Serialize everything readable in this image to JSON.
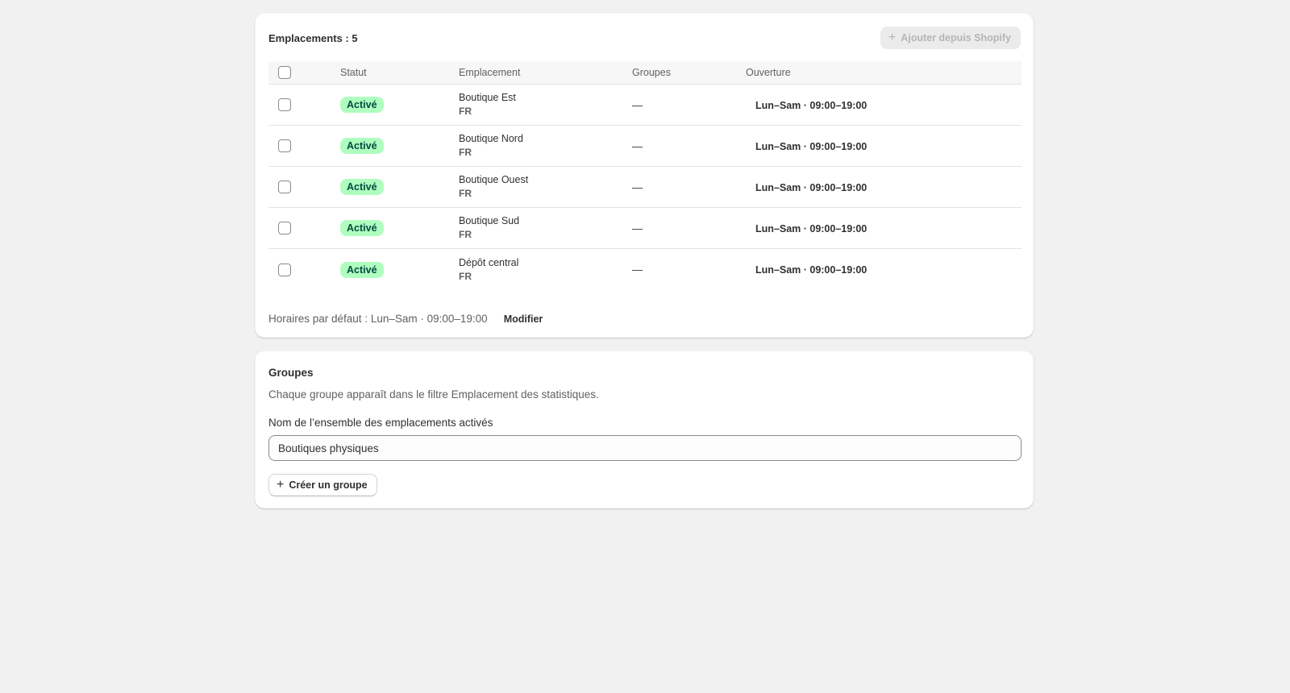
{
  "locations_card": {
    "count_label": "Emplacements : 5",
    "add_button_label": "Ajouter depuis Shopify",
    "add_button_icon": "plus-icon",
    "columns": {
      "status": "Statut",
      "location": "Emplacement",
      "groups": "Groupes",
      "hours": "Ouverture"
    },
    "rows": [
      {
        "status": "Activé",
        "name": "Boutique Est",
        "country": "FR",
        "groups": "—",
        "hours": "Lun–Sam · 09:00–19:00"
      },
      {
        "status": "Activé",
        "name": "Boutique Nord",
        "country": "FR",
        "groups": "—",
        "hours": "Lun–Sam · 09:00–19:00"
      },
      {
        "status": "Activé",
        "name": "Boutique Ouest",
        "country": "FR",
        "groups": "—",
        "hours": "Lun–Sam · 09:00–19:00"
      },
      {
        "status": "Activé",
        "name": "Boutique Sud",
        "country": "FR",
        "groups": "—",
        "hours": "Lun–Sam · 09:00–19:00"
      },
      {
        "status": "Activé",
        "name": "Dépôt central",
        "country": "FR",
        "groups": "—",
        "hours": "Lun–Sam · 09:00–19:00"
      }
    ],
    "default_hours": "Horaires par défaut : Lun–Sam · 09:00–19:00",
    "modify_label": "Modifier"
  },
  "groups_card": {
    "title": "Groupes",
    "description": "Chaque groupe apparaît dans le filtre Emplacement des statistiques.",
    "field_label": "Nom de l’ensemble des emplacements activés",
    "field_value": "Boutiques physiques",
    "create_button_label": "Créer un groupe",
    "create_button_icon": "plus-icon"
  },
  "colors": {
    "page_bg": "#f1f1f1",
    "badge_bg": "#affebf",
    "badge_text": "#014b40"
  }
}
